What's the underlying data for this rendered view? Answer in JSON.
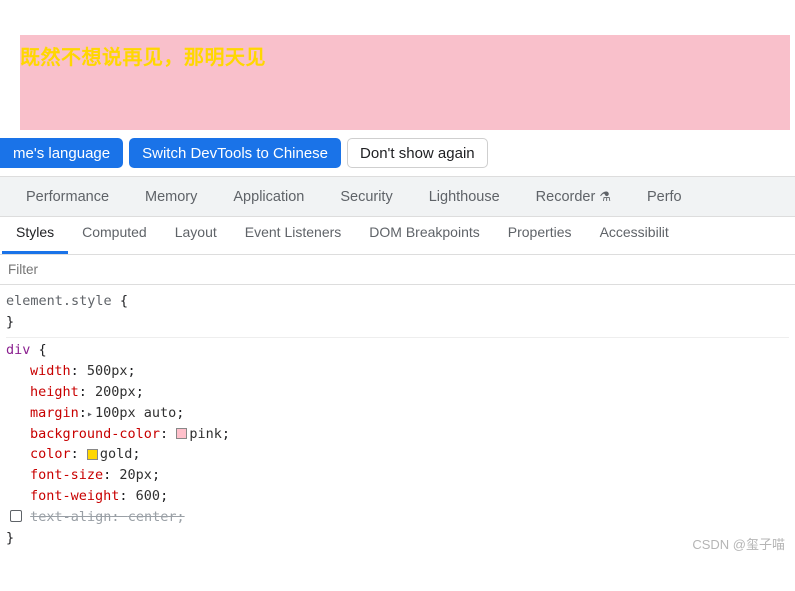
{
  "page": {
    "box_text": "既然不想说再见，那明天见"
  },
  "notice": {
    "lang_btn": "me's language",
    "switch_btn": "Switch DevTools to Chinese",
    "dismiss_btn": "Don't show again"
  },
  "main_tabs": {
    "performance": "Performance",
    "memory": "Memory",
    "application": "Application",
    "security": "Security",
    "lighthouse": "Lighthouse",
    "recorder": "Recorder",
    "perf_overflow": "Perfo"
  },
  "sub_tabs": {
    "styles": "Styles",
    "computed": "Computed",
    "layout": "Layout",
    "event_listeners": "Event Listeners",
    "dom_breakpoints": "DOM Breakpoints",
    "properties": "Properties",
    "accessibility": "Accessibilit"
  },
  "filter": {
    "placeholder": "Filter"
  },
  "styles": {
    "element_selector": "element.style",
    "div_selector": "div",
    "rules": {
      "width": {
        "name": "width",
        "value": "500px"
      },
      "height": {
        "name": "height",
        "value": "200px"
      },
      "margin": {
        "name": "margin",
        "value": "100px auto"
      },
      "bg": {
        "name": "background-color",
        "value": "pink"
      },
      "color": {
        "name": "color",
        "value": "gold"
      },
      "fsize": {
        "name": "font-size",
        "value": "20px"
      },
      "fweight": {
        "name": "font-weight",
        "value": "600"
      },
      "talign": {
        "name": "text-align",
        "value": "center"
      }
    }
  },
  "watermark": "CSDN @玺子喵"
}
